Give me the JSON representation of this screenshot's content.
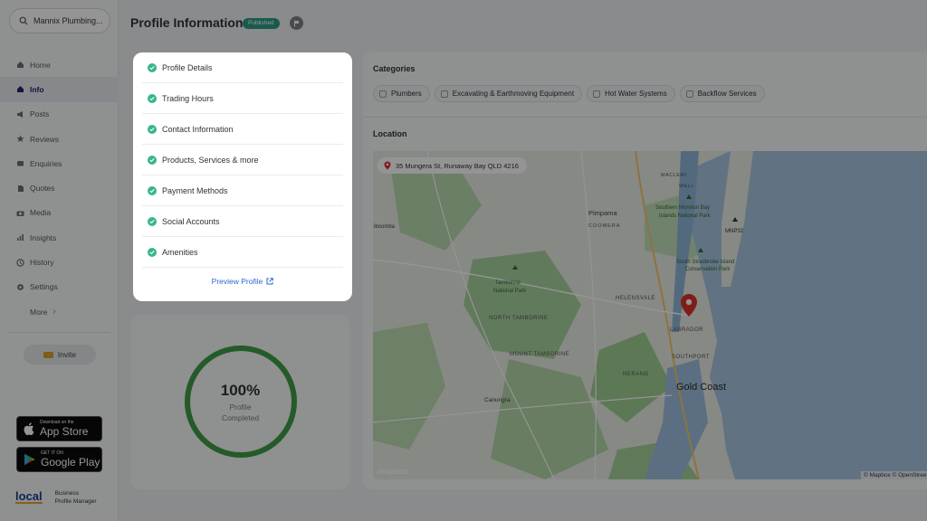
{
  "sidebar": {
    "business_name": "Mannix Plumbing...",
    "items": [
      {
        "label": "Home",
        "icon": "home-icon"
      },
      {
        "label": "Info",
        "icon": "info-icon",
        "active": true
      },
      {
        "label": "Posts",
        "icon": "megaphone-icon"
      },
      {
        "label": "Reviews",
        "icon": "star-icon"
      },
      {
        "label": "Enquiries",
        "icon": "inbox-icon"
      },
      {
        "label": "Quotes",
        "icon": "document-icon"
      },
      {
        "label": "Media",
        "icon": "camera-icon"
      },
      {
        "label": "Insights",
        "icon": "bar-chart-icon"
      },
      {
        "label": "History",
        "icon": "clock-icon"
      },
      {
        "label": "Settings",
        "icon": "gear-icon"
      }
    ],
    "more_label": "More",
    "invite_label": "Invite",
    "app_store": {
      "small": "Download on the",
      "big": "App Store"
    },
    "google_play": {
      "small": "GET IT ON",
      "big": "Google Play"
    },
    "brand": {
      "logo": "local",
      "line1": "Business",
      "line2": "Profile Manager"
    }
  },
  "header": {
    "title": "Profile Information",
    "status_badge": "Published"
  },
  "checklist": {
    "items": [
      "Profile Details",
      "Trading Hours",
      "Contact Information",
      "Products, Services & more",
      "Payment Methods",
      "Social Accounts",
      "Amenities"
    ],
    "preview_label": "Preview Profile"
  },
  "progress": {
    "percent_label": "100%",
    "label_line1": "Profile",
    "label_line2": "Completed",
    "value": 1.0
  },
  "categories": {
    "title": "Categories",
    "items": [
      "Plumbers",
      "Excavating & Earthmoving Equipment",
      "Hot Water Systems",
      "Backflow Services"
    ]
  },
  "location": {
    "title": "Location",
    "address": "35 Mungera St, Runaway Bay QLD 4216",
    "map_labels": {
      "pimpama": "Pimpama",
      "coomera": "COOMERA",
      "smb1": "Southern Moreton Bay",
      "smb2": "Islands National Park",
      "mnp": "MNP32",
      "ssi1": "South Stradbroke Island",
      "ssi2": "Conservation Park",
      "tamb1": "Tamborine",
      "tamb2": "National Park",
      "ntamb": "NORTH TAMBORINE",
      "mtamb": "MOUNT TAMBORINE",
      "ibooba": "iboomba",
      "helen": "HELENSVALE",
      "labr": "LABRADOR",
      "south": "SOUTHPORT",
      "nerang": "NERANG",
      "gold": "Gold Coast",
      "canungra": "Canungra",
      "macleay": "MACLEAY",
      "well": "WELL"
    },
    "mapbox_logo": "mapbox",
    "attribution": "© Mapbox © OpenStreetMap"
  },
  "colors": {
    "accent_blue": "#2f66d2",
    "check_green": "#37b68a",
    "badge_teal": "#2e9c86",
    "ring_green": "#3f9e46",
    "pin_red": "#d9342b"
  }
}
